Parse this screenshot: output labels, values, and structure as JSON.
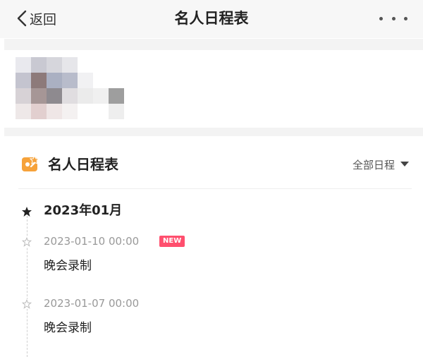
{
  "nav": {
    "back_label": "返回",
    "title": "名人日程表",
    "more_icon": "more-dots-icon"
  },
  "banner": {
    "avatar_note": "pixelated-image"
  },
  "schedule": {
    "section_title": "名人日程表",
    "filter_label": "全部日程",
    "accent_color": "#f6a23a"
  },
  "timeline": {
    "month": "2023年01月",
    "items": [
      {
        "time": "2023-01-10 00:00",
        "badge": "NEW",
        "title": "晚会录制"
      },
      {
        "time": "2023-01-07 00:00",
        "badge": "",
        "title": "晚会录制"
      }
    ]
  }
}
